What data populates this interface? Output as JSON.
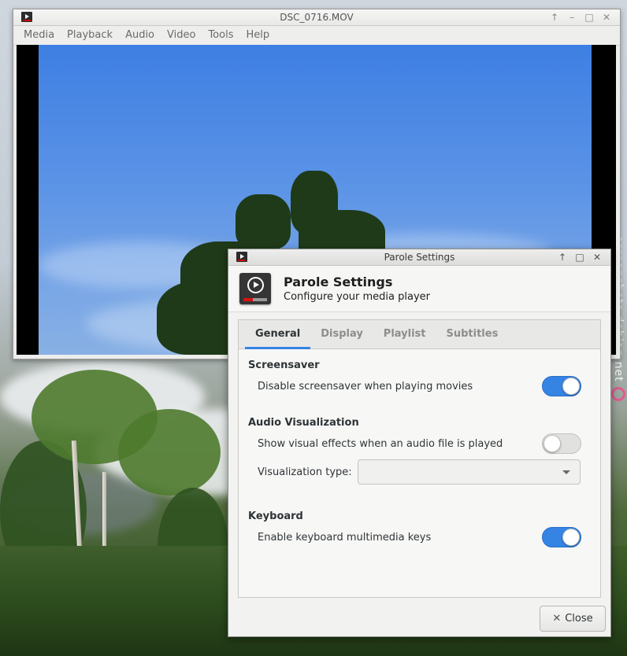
{
  "player": {
    "title": "DSC_0716.MOV",
    "menu": [
      "Media",
      "Playback",
      "Audio",
      "Video",
      "Tools",
      "Help"
    ],
    "window_buttons": [
      "↑",
      "–",
      "□",
      "✕"
    ]
  },
  "dialog": {
    "window_title": "Parole Settings",
    "window_buttons": [
      "↑",
      "□",
      "✕"
    ],
    "header_title": "Parole Settings",
    "header_subtitle": "Configure your media player",
    "tabs": [
      "General",
      "Display",
      "Playlist",
      "Subtitles"
    ],
    "active_tab": "General",
    "sections": {
      "screensaver": {
        "title": "Screensaver",
        "option_label": "Disable screensaver when playing movies",
        "enabled": true
      },
      "audio_visualization": {
        "title": "Audio Visualization",
        "option_label": "Show visual effects when an audio file is played",
        "enabled": false,
        "type_label": "Visualization type:",
        "type_value": ""
      },
      "keyboard": {
        "title": "Keyboard",
        "option_label": "Enable keyboard multimedia keys",
        "enabled": true
      }
    },
    "close_label": "Close"
  },
  "watermark": "screenshots.debian.net",
  "colors": {
    "accent": "#3584e4",
    "switch_off": "#e1e1e0"
  },
  "icons": [
    "parole-app-icon",
    "parole-logo-icon",
    "close-x-icon",
    "dropdown-caret-icon"
  ]
}
